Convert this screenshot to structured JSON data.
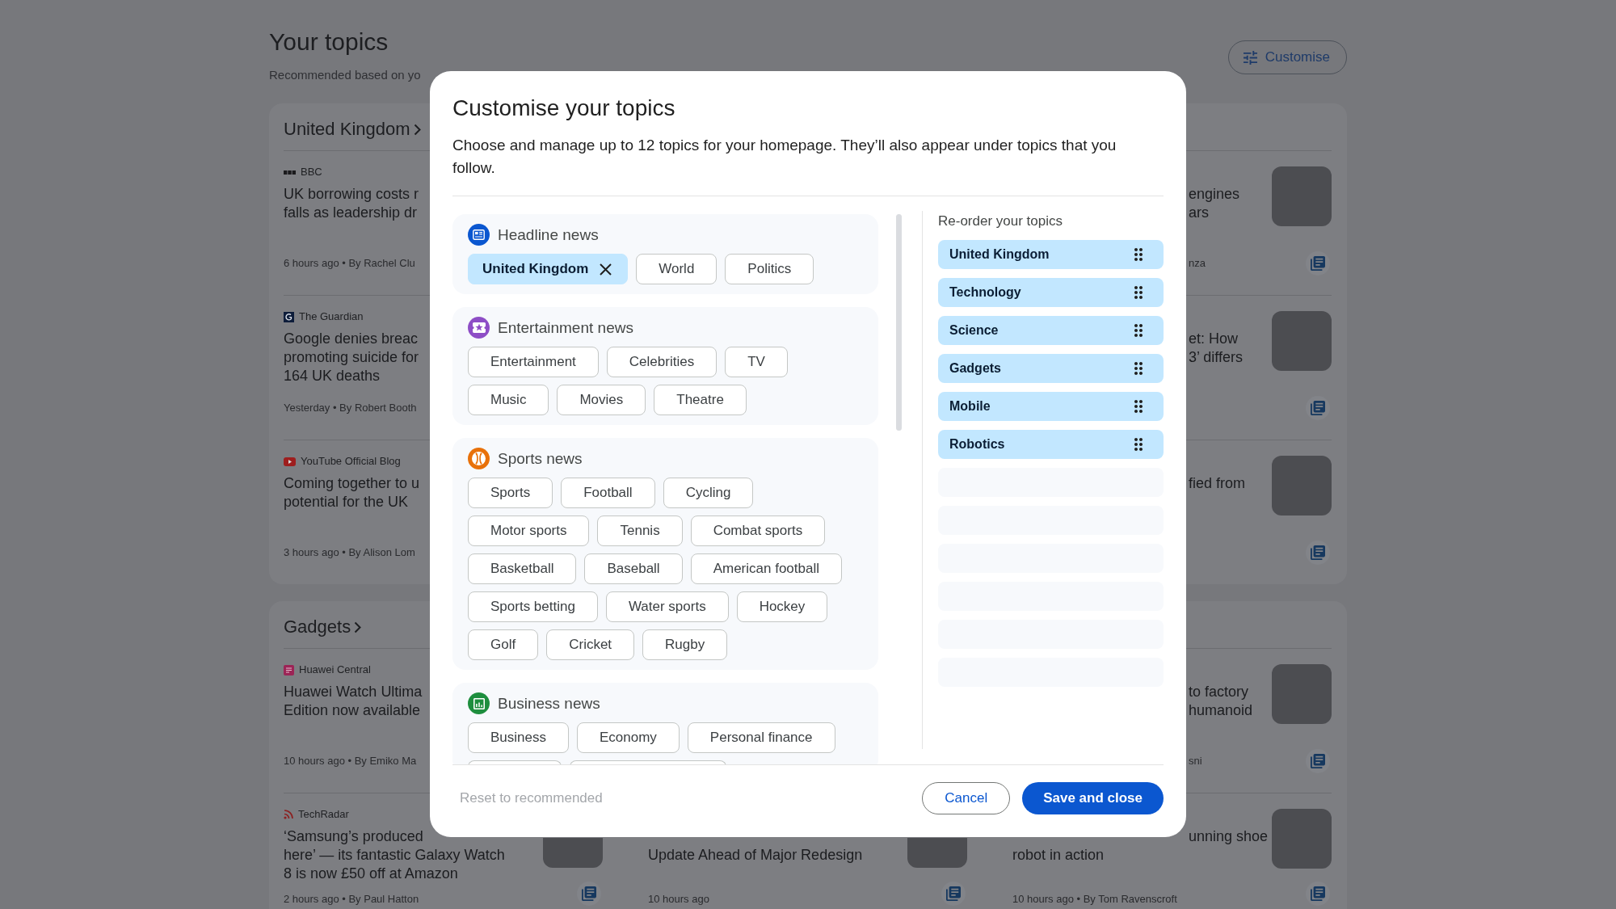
{
  "page": {
    "title": "Your topics",
    "subtitle": "Recommended based on yo",
    "customise_button": "Customise"
  },
  "sections": [
    {
      "title": "United Kingdom",
      "rows": [
        {
          "left": {
            "kind": "full",
            "source": "BBC",
            "headline": [
              {
                "text": "UK borrowing costs r",
                "tail": false
              },
              {
                "text": "falls as leadership dr",
                "tail": false
              }
            ],
            "meta": {
              "text": "6 hours ago • By Rachel Clu"
            }
          },
          "right": {
            "kind": "full",
            "headline": [
              {
                "text": "engines",
                "tail": true
              },
              {
                "text": "ars",
                "tail": true
              }
            ],
            "meta": {
              "text": "nza",
              "tail": true
            },
            "thumbnail": {
              "kind": "full"
            },
            "coverage_icon": true
          }
        },
        {
          "left": {
            "kind": "full",
            "source": "The Guardian",
            "headline": [
              {
                "text": "Google denies breac",
                "tail": false
              },
              {
                "text": "promoting suicide for",
                "tail": false
              },
              {
                "text": "164 UK deaths",
                "tail": false
              }
            ],
            "meta": {
              "text": "Yesterday • By Robert Booth"
            }
          },
          "right": {
            "kind": "full",
            "headline": [
              {
                "text": "et: How",
                "tail": true
              },
              {
                "text": "3’ differs",
                "tail": true
              }
            ],
            "thumbnail": {
              "kind": "full"
            },
            "coverage_icon": true
          }
        },
        {
          "left": {
            "kind": "full",
            "source": "YouTube Official Blog",
            "headline": [
              {
                "text": "Coming together to u",
                "tail": false
              },
              {
                "text": "potential for the UK",
                "tail": false
              }
            ],
            "meta": {
              "text": "3 hours ago • By Alison Lom"
            }
          },
          "right": {
            "kind": "full",
            "headline": [
              {
                "text": "fied from",
                "tail": true
              }
            ],
            "thumbnail": {
              "kind": "full"
            },
            "coverage_icon": true
          }
        }
      ]
    },
    {
      "title": "Gadgets",
      "rows": [
        {
          "left": {
            "kind": "full",
            "source": "Huawei Central",
            "headline": [
              {
                "text": "Huawei Watch Ultima",
                "tail": false
              },
              {
                "text": "Edition now available",
                "tail": false
              }
            ],
            "meta": {
              "text": "10 hours ago • By Emiko Ma"
            }
          },
          "right": {
            "kind": "full",
            "headline": [
              {
                "text": "to factory",
                "tail": true
              },
              {
                "text": "humanoid",
                "tail": true
              }
            ],
            "meta": {
              "text": "sni",
              "tail": true
            },
            "thumbnail": {
              "kind": "full"
            },
            "coverage_icon": true
          }
        },
        {
          "left": {
            "kind": "full",
            "source": "TechRadar",
            "headline": [
              {
                "text": "‘Samsung’s produced",
                "tail": false
              },
              {
                "text": "here’ — its fantastic Galaxy Watch",
                "tail": false
              },
              {
                "text": "8 is now £50 off at Amazon",
                "tail": false
              }
            ],
            "meta": {
              "text": "2 hours ago • By Paul Hatton"
            },
            "thumbnail": {
              "kind": "lower"
            },
            "coverage_icon": true
          },
          "middle": {
            "kind": "lower",
            "headline": [
              {
                "text": "Update Ahead of Major Redesign",
                "tail": false
              }
            ],
            "meta": {
              "text": "10 hours ago"
            },
            "thumbnail": {
              "kind": "lower"
            },
            "coverage_icon": true
          },
          "right": {
            "kind": "full",
            "headline": [
              {
                "text": "unning shoe",
                "tail": true
              },
              {
                "text": "robot in action",
                "tail": false
              }
            ],
            "meta": {
              "text": "10 hours ago • By Tom Ravenscroft"
            },
            "thumbnail": {
              "kind": "full"
            },
            "coverage_icon": true
          }
        }
      ]
    }
  ],
  "dialog": {
    "title": "Customise your topics",
    "description": "Choose and manage up to 12 topics for your homepage. They’ll also appear under topics that you follow.",
    "groups": [
      {
        "title": "Headline news",
        "color": "#0b57d0",
        "rows": [
          {
            "chips": [
              {
                "kind": "chip",
                "label": "United Kingdom",
                "selected": true
              },
              {
                "kind": "chip",
                "label": "World",
                "selected": false
              },
              {
                "kind": "chip",
                "label": "Politics",
                "selected": false
              }
            ]
          }
        ]
      },
      {
        "title": "Entertainment news",
        "color": "#8e4ec6",
        "rows": [
          {
            "chips": [
              {
                "kind": "chip",
                "label": "Entertainment",
                "selected": false
              },
              {
                "kind": "chip",
                "label": "Celebrities",
                "selected": false
              },
              {
                "kind": "chip",
                "label": "TV",
                "selected": false
              }
            ]
          },
          {
            "chips": [
              {
                "kind": "chip",
                "label": "Music",
                "selected": false
              },
              {
                "kind": "chip",
                "label": "Movies",
                "selected": false
              },
              {
                "kind": "chip",
                "label": "Theatre",
                "selected": false
              }
            ]
          }
        ]
      },
      {
        "title": "Sports news",
        "color": "#e8710a",
        "rows": [
          {
            "chips": [
              {
                "kind": "chip",
                "label": "Sports",
                "selected": false
              },
              {
                "kind": "chip",
                "label": "Football",
                "selected": false
              },
              {
                "kind": "chip",
                "label": "Cycling",
                "selected": false
              }
            ]
          },
          {
            "chips": [
              {
                "kind": "chip",
                "label": "Motor sports",
                "selected": false
              },
              {
                "kind": "chip",
                "label": "Tennis",
                "selected": false
              },
              {
                "kind": "chip",
                "label": "Combat sports",
                "selected": false
              }
            ]
          },
          {
            "chips": [
              {
                "kind": "chip",
                "label": "Basketball",
                "selected": false
              },
              {
                "kind": "chip",
                "label": "Baseball",
                "selected": false
              },
              {
                "kind": "chip",
                "label": "American football",
                "selected": false
              }
            ]
          },
          {
            "chips": [
              {
                "kind": "chip",
                "label": "Sports betting",
                "selected": false
              },
              {
                "kind": "chip",
                "label": "Water sports",
                "selected": false
              },
              {
                "kind": "chip",
                "label": "Hockey",
                "selected": false
              }
            ]
          },
          {
            "chips": [
              {
                "kind": "chip",
                "label": "Golf",
                "selected": false
              },
              {
                "kind": "chip",
                "label": "Cricket",
                "selected": false
              },
              {
                "kind": "chip",
                "label": "Rugby",
                "selected": false
              }
            ]
          }
        ]
      },
      {
        "title": "Business news",
        "color": "#1e8e3e",
        "rows": [
          {
            "chips": [
              {
                "kind": "chip",
                "label": "Business",
                "selected": false
              },
              {
                "kind": "chip",
                "label": "Economy",
                "selected": false
              },
              {
                "kind": "chip",
                "label": "Personal finance",
                "selected": false
              }
            ]
          },
          {
            "chips": [
              {
                "kind": "cut"
              },
              {
                "kind": "cut"
              }
            ]
          }
        ]
      }
    ],
    "reorder": {
      "title": "Re-order your topics",
      "slots": [
        {
          "kind": "topic",
          "label": "United Kingdom"
        },
        {
          "kind": "topic",
          "label": "Technology"
        },
        {
          "kind": "topic",
          "label": "Science"
        },
        {
          "kind": "topic",
          "label": "Gadgets"
        },
        {
          "kind": "topic",
          "label": "Mobile"
        },
        {
          "kind": "topic",
          "label": "Robotics"
        },
        {
          "kind": "empty"
        },
        {
          "kind": "empty"
        },
        {
          "kind": "empty"
        },
        {
          "kind": "empty"
        },
        {
          "kind": "empty"
        },
        {
          "kind": "empty"
        }
      ]
    },
    "reset_button": {
      "label": "Reset to recommended",
      "disabled": true
    },
    "cancel_button": "Cancel",
    "save_button": "Save and close"
  }
}
